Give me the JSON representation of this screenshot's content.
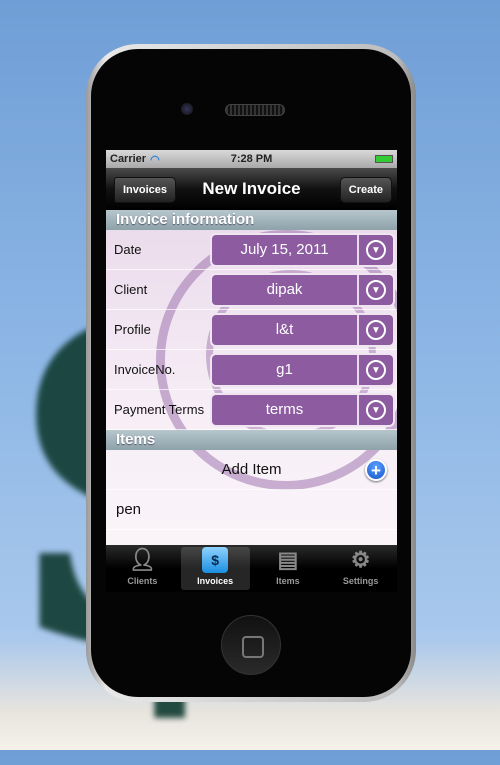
{
  "status": {
    "carrier": "Carrier",
    "time": "7:28 PM"
  },
  "nav": {
    "back": "Invoices",
    "title": "New Invoice",
    "create": "Create"
  },
  "sections": {
    "info": "Invoice information",
    "items": "Items"
  },
  "fields": [
    {
      "label": "Date",
      "value": "July 15, 2011"
    },
    {
      "label": "Client",
      "value": "dipak"
    },
    {
      "label": "Profile",
      "value": "l&t"
    },
    {
      "label": "InvoiceNo.",
      "value": "g1"
    },
    {
      "label": "Payment Terms",
      "value": "terms"
    }
  ],
  "items": {
    "add": "Add Item",
    "list": [
      "pen"
    ]
  },
  "tabs": [
    {
      "label": "Clients",
      "icon": "person-icon"
    },
    {
      "label": "Invoices",
      "icon": "invoice-icon",
      "active": true
    },
    {
      "label": "Items",
      "icon": "database-icon"
    },
    {
      "label": "Settings",
      "icon": "gear-icon"
    }
  ],
  "colors": {
    "field": "#8c5ba0",
    "accent": "#1a55c8"
  }
}
